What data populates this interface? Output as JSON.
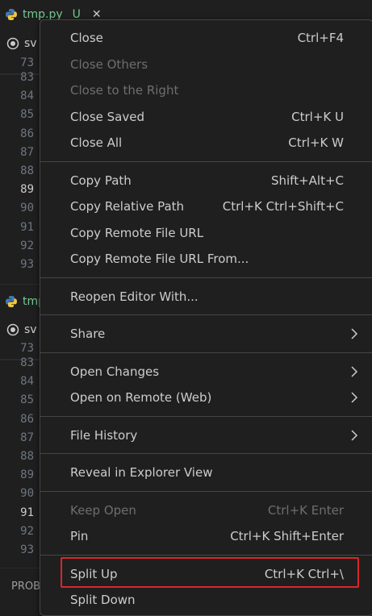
{
  "editor": {
    "top_group": {
      "tab_name": "tmp.py",
      "tab_status": "U",
      "breadcrumb": "sv",
      "sticky_line": "73",
      "lines": [
        "83",
        "84",
        "85",
        "86",
        "87",
        "88",
        "89",
        "90",
        "91",
        "92",
        "93"
      ],
      "active_line": "89"
    },
    "bottom_group": {
      "tab_name": "tmp",
      "breadcrumb": "sv",
      "sticky_line": "73",
      "lines": [
        "83",
        "84",
        "85",
        "86",
        "87",
        "88",
        "89",
        "90",
        "91",
        "92",
        "93"
      ],
      "active_line": "91"
    },
    "panel_tab": "PROB"
  },
  "menu": {
    "items": [
      {
        "label": "Close",
        "shortcut": "Ctrl+F4",
        "enabled": true
      },
      {
        "label": "Close Others",
        "shortcut": "",
        "enabled": false
      },
      {
        "label": "Close to the Right",
        "shortcut": "",
        "enabled": false
      },
      {
        "label": "Close Saved",
        "shortcut": "Ctrl+K U",
        "enabled": true
      },
      {
        "label": "Close All",
        "shortcut": "Ctrl+K W",
        "enabled": true
      },
      {
        "label": "Copy Path",
        "shortcut": "Shift+Alt+C",
        "enabled": true
      },
      {
        "label": "Copy Relative Path",
        "shortcut": "Ctrl+K Ctrl+Shift+C",
        "enabled": true
      },
      {
        "label": "Copy Remote File URL",
        "shortcut": "",
        "enabled": true
      },
      {
        "label": "Copy Remote File URL From...",
        "shortcut": "",
        "enabled": true
      },
      {
        "label": "Reopen Editor With...",
        "shortcut": "",
        "enabled": true
      },
      {
        "label": "Share",
        "shortcut": "",
        "enabled": true,
        "submenu": true
      },
      {
        "label": "Open Changes",
        "shortcut": "",
        "enabled": true,
        "submenu": true
      },
      {
        "label": "Open on Remote (Web)",
        "shortcut": "",
        "enabled": true,
        "submenu": true
      },
      {
        "label": "File History",
        "shortcut": "",
        "enabled": true,
        "submenu": true
      },
      {
        "label": "Reveal in Explorer View",
        "shortcut": "",
        "enabled": true
      },
      {
        "label": "Keep Open",
        "shortcut": "Ctrl+K Enter",
        "enabled": false
      },
      {
        "label": "Pin",
        "shortcut": "Ctrl+K Shift+Enter",
        "enabled": true
      },
      {
        "label": "Split Up",
        "shortcut": "Ctrl+K Ctrl+\\",
        "enabled": true,
        "highlighted": true
      },
      {
        "label": "Split Down",
        "shortcut": "",
        "enabled": true
      }
    ],
    "highlight_color": "#d9262e"
  },
  "icons": {
    "python": "python-file-icon",
    "close": "close-icon",
    "symbol": "symbol-circle-icon",
    "submenu": "chevron-right-icon"
  }
}
